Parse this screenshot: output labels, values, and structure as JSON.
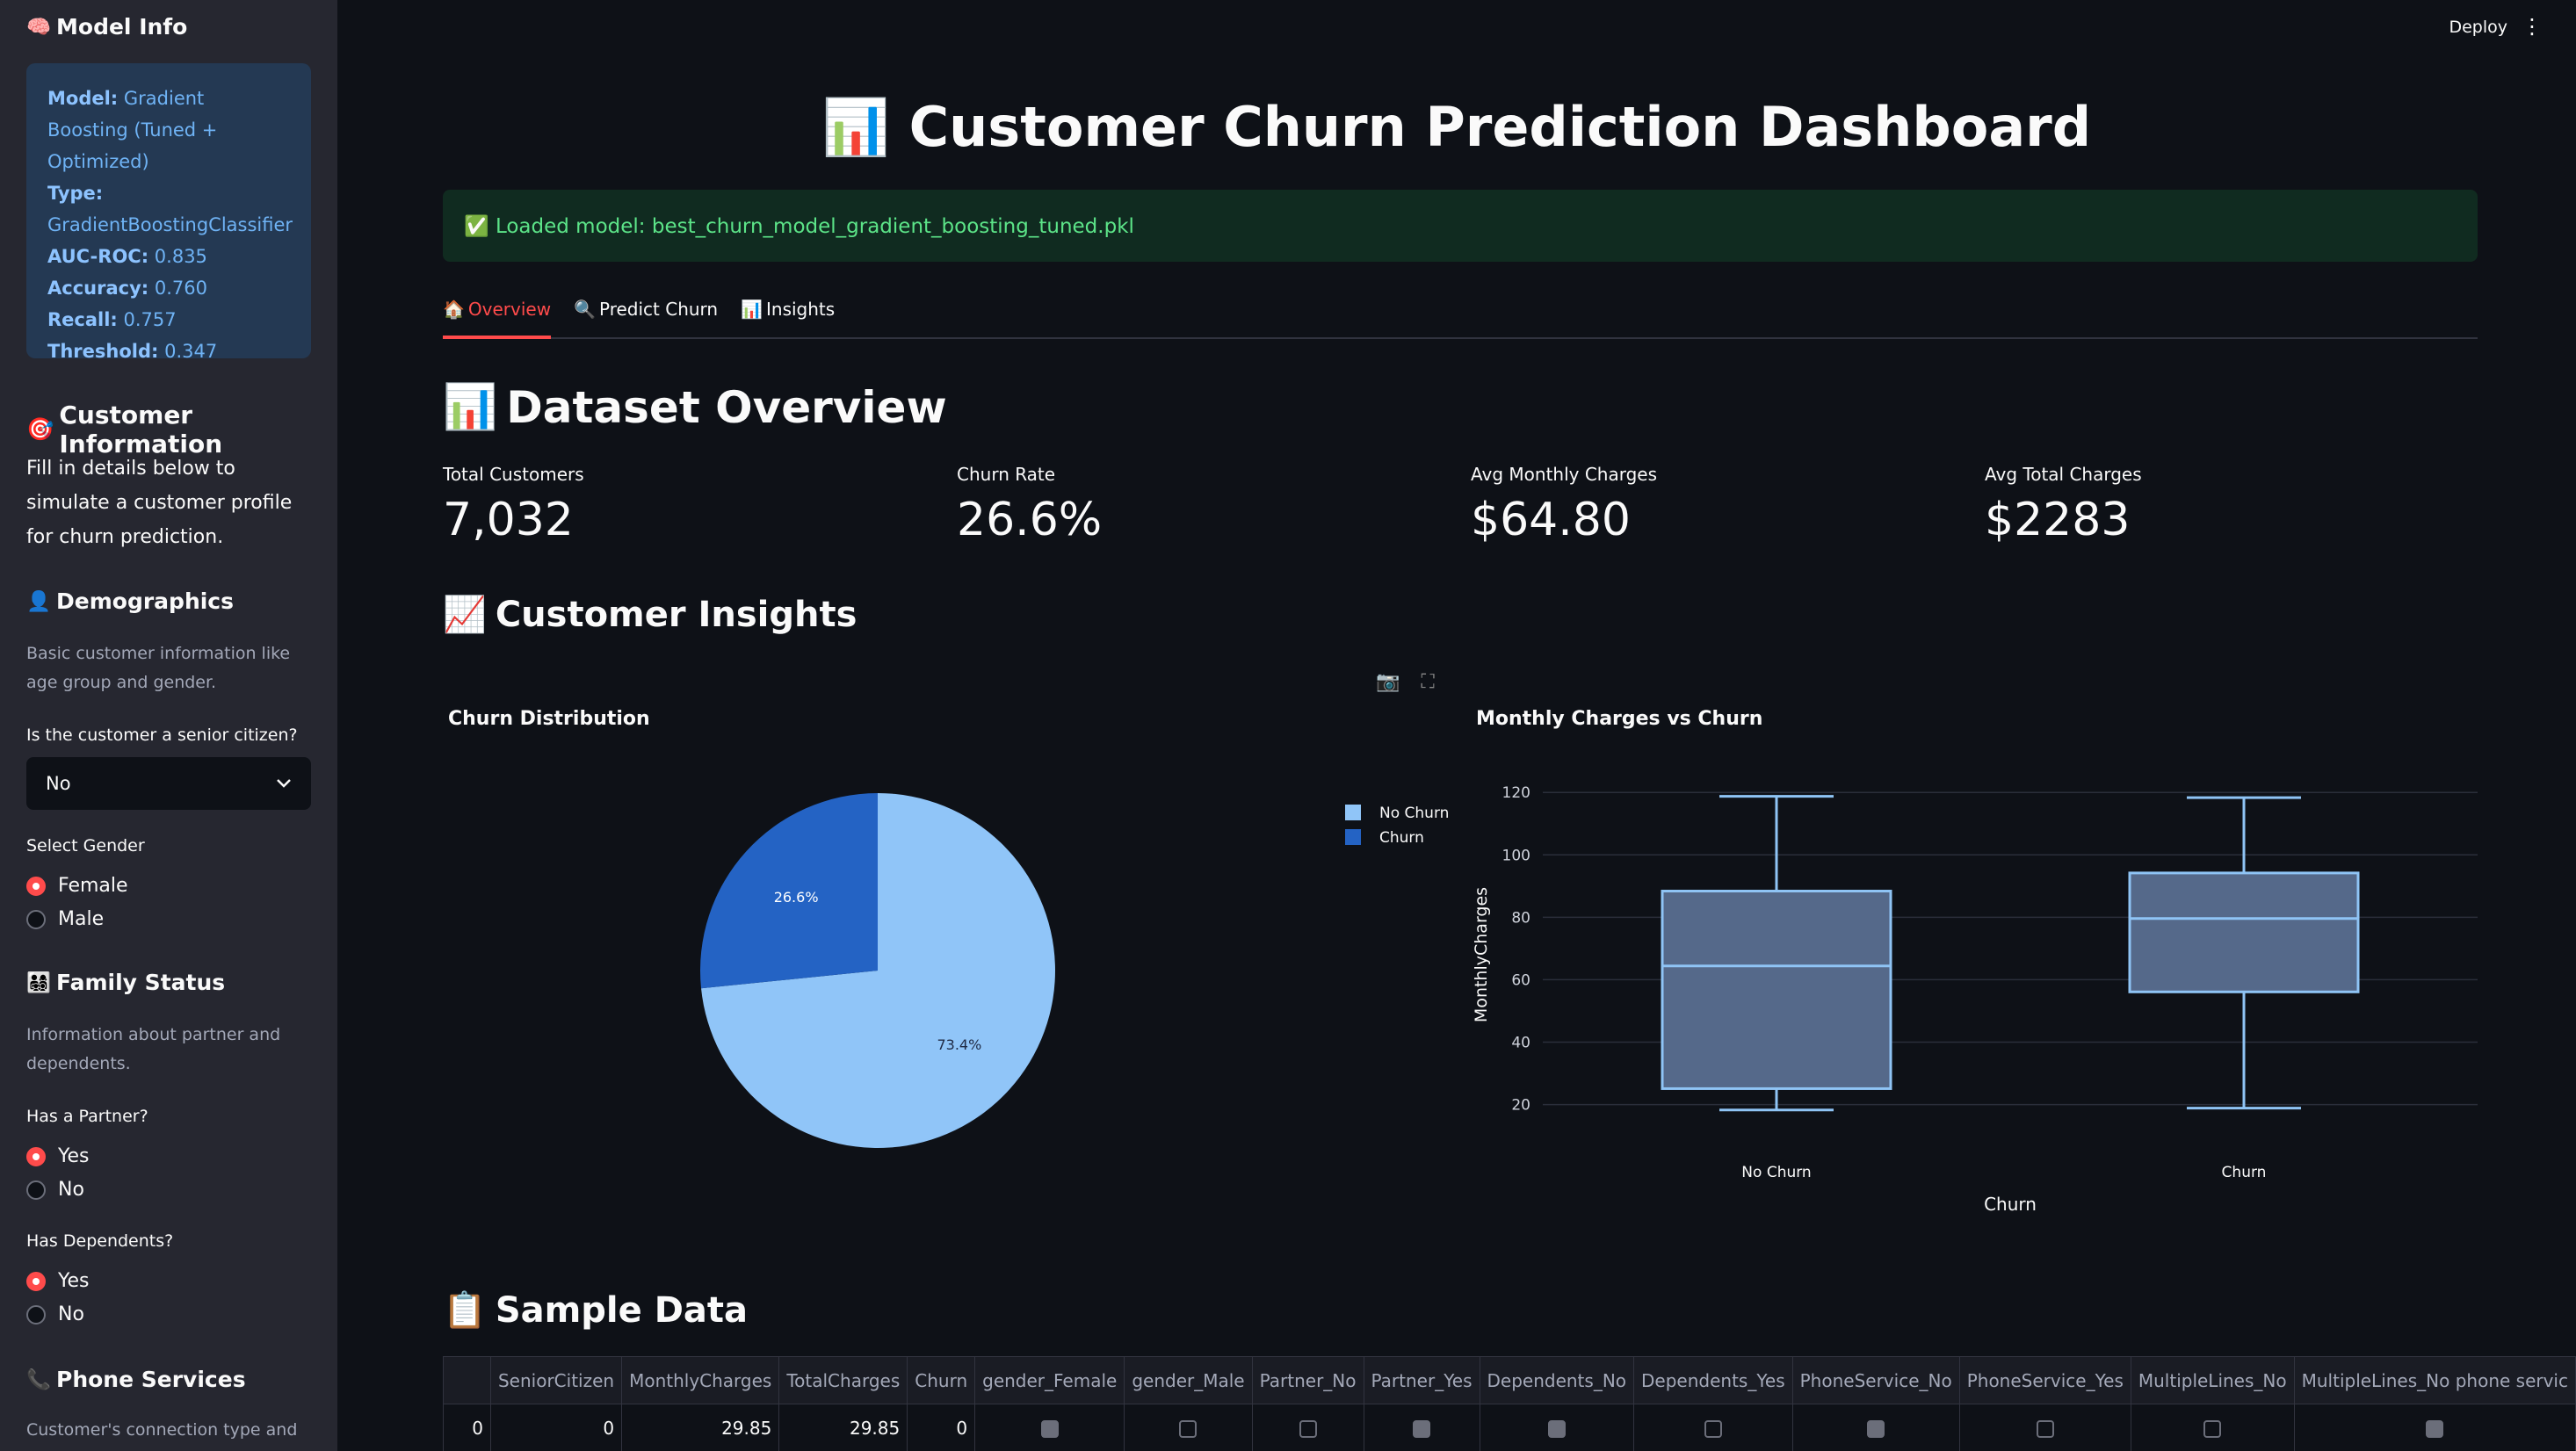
{
  "sidebar": {
    "model_info_title": "Model Info",
    "model_info_icon": "brain-emoji",
    "model": {
      "model_label": "Model:",
      "model_value": "Gradient Boosting (Tuned + Optimized)",
      "type_label": "Type:",
      "type_value": "GradientBoostingClassifier",
      "auc_label": "AUC-ROC:",
      "auc_value": "0.835",
      "acc_label": "Accuracy:",
      "acc_value": "0.760",
      "recall_label": "Recall:",
      "recall_value": "0.757",
      "thr_label": "Threshold:",
      "thr_value": "0.347"
    },
    "customer_info_title": "Customer Information",
    "customer_info_text": "Fill in details below to simulate a customer profile for churn prediction.",
    "demographics_title": "Demographics",
    "demographics_caption": "Basic customer information like age group and gender.",
    "senior_label": "Is the customer a senior citizen?",
    "senior_value": "No",
    "gender_label": "Select Gender",
    "gender_options": [
      "Female",
      "Male"
    ],
    "gender_selected": "Female",
    "family_title": "Family Status",
    "family_caption": "Information about partner and dependents.",
    "partner_label": "Has a Partner?",
    "partner_options": [
      "Yes",
      "No"
    ],
    "dependents_label": "Has Dependents?",
    "dependents_options": [
      "Yes",
      "No"
    ],
    "phone_title": "Phone Services",
    "phone_caption": "Customer's connection type and line"
  },
  "header": {
    "deploy_label": "Deploy",
    "menu_icon": "kebab-menu-icon"
  },
  "main": {
    "title": "Customer Churn Prediction Dashboard",
    "success_message": "✅ Loaded model: best_churn_model_gradient_boosting_tuned.pkl",
    "tabs": [
      {
        "icon": "🏠",
        "label": "Overview"
      },
      {
        "icon": "🔍",
        "label": "Predict Churn"
      },
      {
        "icon": "📊",
        "label": "Insights"
      }
    ],
    "dataset_title": "Dataset Overview",
    "metrics": [
      {
        "label": "Total Customers",
        "value": "7,032"
      },
      {
        "label": "Churn Rate",
        "value": "26.6%"
      },
      {
        "label": "Avg Monthly Charges",
        "value": "$64.80"
      },
      {
        "label": "Avg Total Charges",
        "value": "$2283"
      }
    ],
    "insights_title": "Customer Insights",
    "sample_title": "Sample Data"
  },
  "chart_data": [
    {
      "type": "pie",
      "title": "Churn Distribution",
      "labels": [
        "No Churn",
        "Churn"
      ],
      "values": [
        73.4,
        26.6
      ],
      "value_labels": [
        "73.4%",
        "26.6%"
      ],
      "colors": [
        "#90c5f8",
        "#2463c4"
      ],
      "legend": "right"
    },
    {
      "type": "box",
      "title": "Monthly Charges vs Churn",
      "xlabel": "Churn",
      "ylabel": "MonthlyCharges",
      "categories": [
        "No Churn",
        "Churn"
      ],
      "yticks": [
        20,
        40,
        60,
        80,
        100,
        120
      ],
      "ylim": [
        12,
        124
      ],
      "boxes": [
        {
          "min": 18.25,
          "q1": 25.1,
          "median": 64.4,
          "q3": 88.4,
          "max": 118.75
        },
        {
          "min": 18.85,
          "q1": 56.1,
          "median": 79.6,
          "q3": 94.2,
          "max": 118.35
        }
      ],
      "grid": true
    }
  ],
  "table": {
    "columns": [
      "",
      "SeniorCitizen",
      "MonthlyCharges",
      "TotalCharges",
      "Churn",
      "gender_Female",
      "gender_Male",
      "Partner_No",
      "Partner_Yes",
      "Dependents_No",
      "Dependents_Yes",
      "PhoneService_No",
      "PhoneService_Yes",
      "MultipleLines_No",
      "MultipleLines_No phone servic"
    ],
    "row": {
      "index": "0",
      "SeniorCitizen": "0",
      "MonthlyCharges": "29.85",
      "TotalCharges": "29.85",
      "Churn": "0",
      "checks": [
        true,
        false,
        false,
        true,
        true,
        false,
        true,
        false,
        false,
        true
      ]
    }
  }
}
